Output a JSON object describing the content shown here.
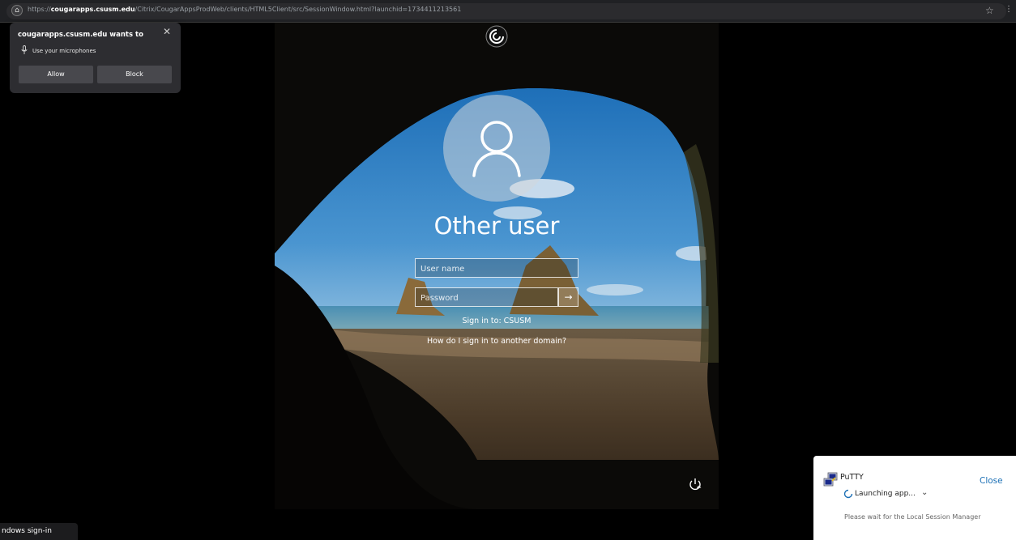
{
  "browser": {
    "url_prefix": "https://",
    "url_domain": "cougarapps.csusm.edu",
    "url_path": "/Citrix/CougarAppsProdWeb/clients/HTML5Client/src/SessionWindow.html?launchid=1734411213561"
  },
  "permission_popup": {
    "title": "cougarapps.csusm.edu wants to",
    "request": "Use your microphones",
    "allow_label": "Allow",
    "block_label": "Block"
  },
  "lock_screen": {
    "user_title": "Other user",
    "username_placeholder": "User name",
    "password_placeholder": "Password",
    "sign_in_to": "Sign in to: CSUSM",
    "other_domain_link": "How do I sign in to another domain?"
  },
  "status_bar": {
    "text": "ndows sign-in"
  },
  "toast": {
    "app_name": "PuTTY",
    "close_label": "Close",
    "status": "Launching app...",
    "message": "Please wait for the Local Session Manager"
  },
  "colors": {
    "toast_link": "#1a6fb5",
    "popup_bg": "#2d2d31",
    "button_bg": "#48484d"
  }
}
